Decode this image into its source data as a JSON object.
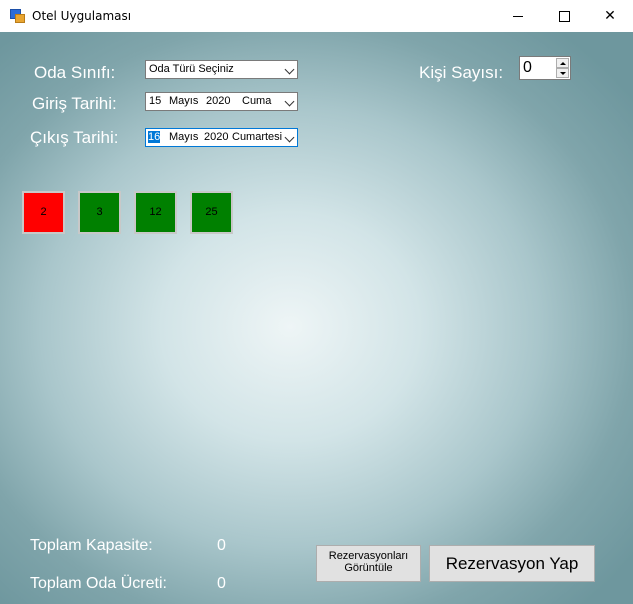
{
  "window": {
    "title": "Otel Uygulaması"
  },
  "form": {
    "room_class_label": "Oda Sınıfı:",
    "room_class_value": "Oda Türü Seçiniz",
    "checkin_label": "Giriş Tarihi:",
    "checkin": {
      "day": "15",
      "month": "Mayıs",
      "year": "2020",
      "weekday": "Cuma"
    },
    "checkout_label": "Çıkış Tarihi:",
    "checkout": {
      "day": "16",
      "month": "Mayıs",
      "year": "2020",
      "weekday": "Cumartesi"
    },
    "person_count_label": "Kişi Sayısı:",
    "person_count_value": "0"
  },
  "rooms": [
    {
      "number": "2",
      "color": "#ff0000"
    },
    {
      "number": "3",
      "color": "#008000"
    },
    {
      "number": "12",
      "color": "#008000"
    },
    {
      "number": "25",
      "color": "#008000"
    }
  ],
  "summary": {
    "capacity_label": "Toplam Kapasite:",
    "capacity_value": "0",
    "price_label": "Toplam Oda Ücreti:",
    "price_value": "0"
  },
  "buttons": {
    "view_reservations_line1": "Rezervasyonları",
    "view_reservations_line2": "Görüntüle",
    "make_reservation": "Rezervasyon Yap"
  }
}
